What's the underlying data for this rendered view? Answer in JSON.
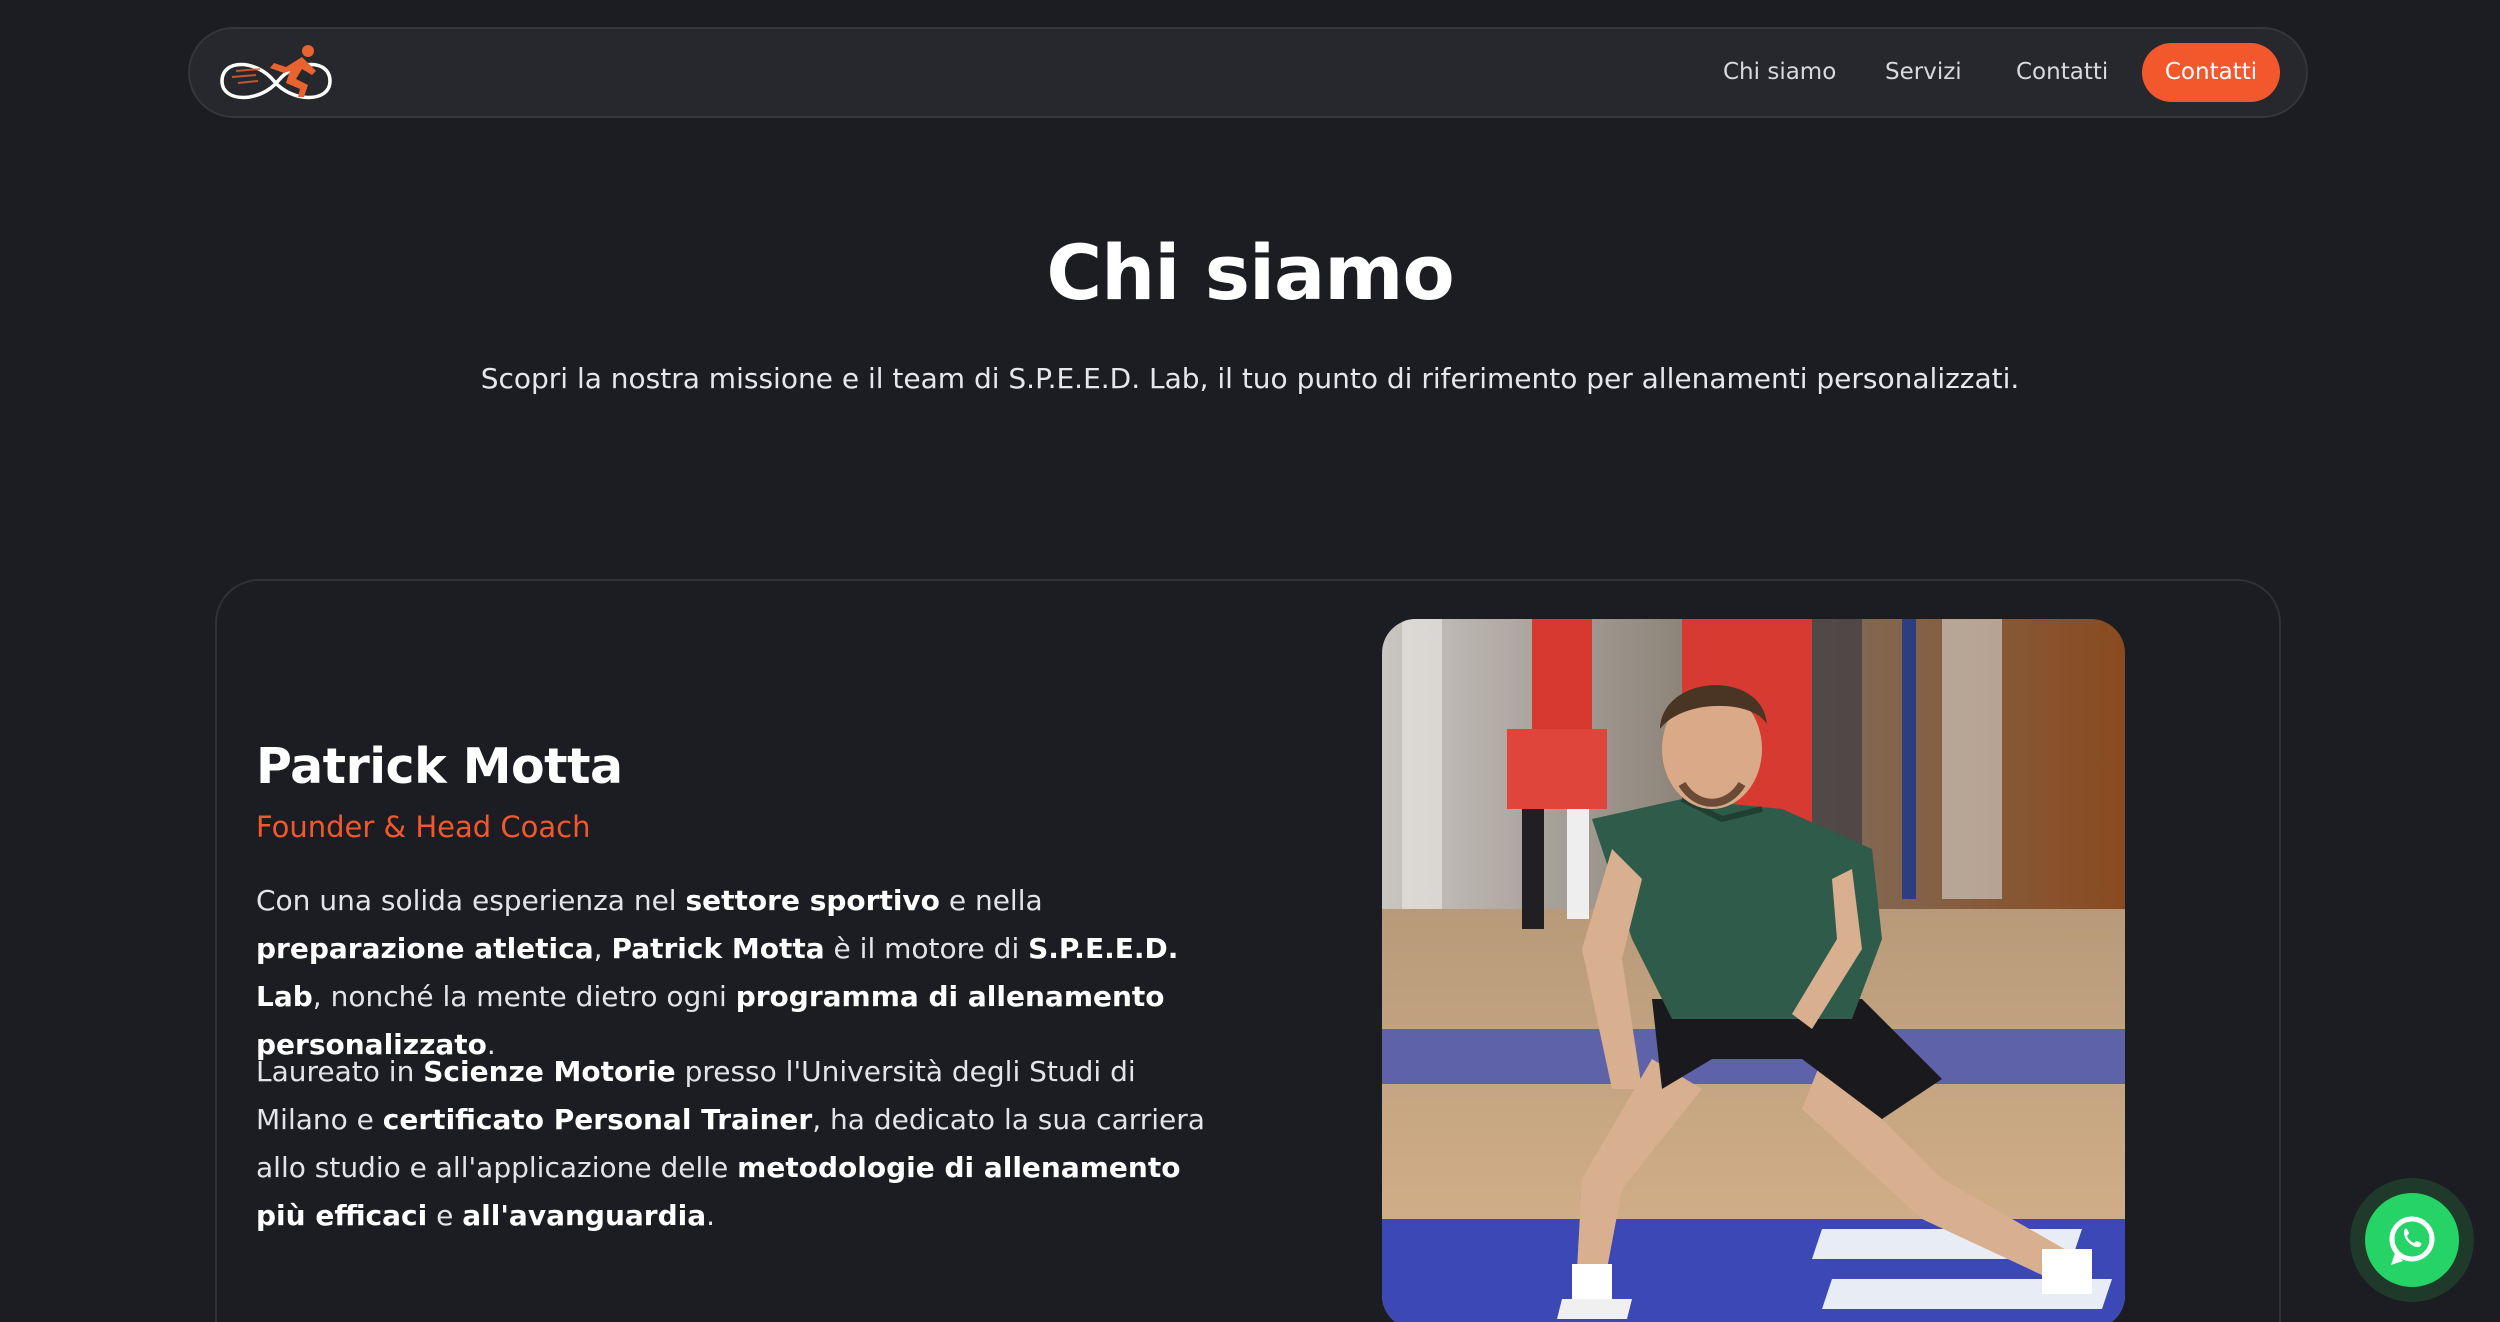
{
  "nav": {
    "links": [
      "Chi siamo",
      "Servizi",
      "Contatti"
    ],
    "cta_label": "Contatti",
    "logo_icon": "runner-infinity-logo"
  },
  "hero": {
    "title": "Chi siamo",
    "subtitle": "Scopri la nostra missione e il team di S.P.E.E.D. Lab, il tuo punto di riferimento per allenamenti personalizzati."
  },
  "profile": {
    "name": "Patrick Motta",
    "role": "Founder & Head Coach",
    "p1": [
      {
        "t": "Con una solida esperienza nel ",
        "b": false
      },
      {
        "t": "settore sportivo",
        "b": true
      },
      {
        "t": " e nella ",
        "b": false
      },
      {
        "t": "preparazione atletica",
        "b": true
      },
      {
        "t": ", ",
        "b": false
      },
      {
        "t": "Patrick Motta",
        "b": true
      },
      {
        "t": " è il motore di ",
        "b": false
      },
      {
        "t": "S.P.E.E.D. Lab",
        "b": true
      },
      {
        "t": ", nonché la mente dietro ogni ",
        "b": false
      },
      {
        "t": "programma di allenamento personalizzato",
        "b": true
      },
      {
        "t": ".",
        "b": false
      }
    ],
    "p2": [
      {
        "t": "Laureato in ",
        "b": false
      },
      {
        "t": "Scienze Motorie",
        "b": true
      },
      {
        "t": " presso l'Università degli Studi di Milano e ",
        "b": false
      },
      {
        "t": "certificato Personal Trainer",
        "b": true
      },
      {
        "t": ", ha dedicato la sua carriera allo studio e all'applicazione delle ",
        "b": false
      },
      {
        "t": "metodologie di allenamento più efficaci",
        "b": true
      },
      {
        "t": " e ",
        "b": false
      },
      {
        "t": "all'avanguardia",
        "b": true
      },
      {
        "t": ".",
        "b": false
      }
    ],
    "photo_icon": "coach-photo"
  },
  "fab": {
    "icon": "whatsapp-icon",
    "color": "#25d366"
  },
  "colors": {
    "accent": "#f2582c",
    "background": "#1b1d22"
  }
}
